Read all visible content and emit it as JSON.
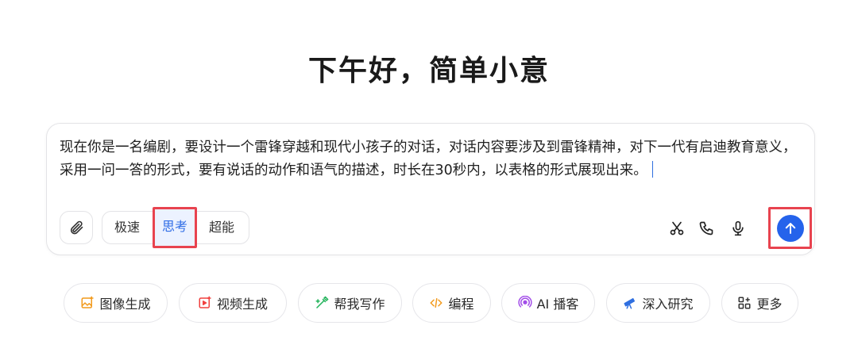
{
  "greeting": "下午好，简单小意",
  "composer": {
    "prompt_text": "现在你是一名编剧，要设计一个雷锋穿越和现代小孩子的对话，对话内容要涉及到雷锋精神，对下一代有启迪教育意义，采用一问一答的形式，要有说话的动作和语气的描述，时长在30秒内，以表格的形式展现出来。",
    "modes": [
      "极速",
      "思考",
      "超能"
    ],
    "active_mode": "思考"
  },
  "icons": {
    "attach": "paperclip-icon",
    "cut": "scissors-icon",
    "phone": "phone-icon",
    "mic": "microphone-icon",
    "send": "arrow-up-icon"
  },
  "chips": [
    {
      "label": "图像生成",
      "icon": "image-generate-icon",
      "color": "#f29a1c"
    },
    {
      "label": "视频生成",
      "icon": "video-generate-icon",
      "color": "#f0413f"
    },
    {
      "label": "帮我写作",
      "icon": "pen-write-icon",
      "color": "#21b35a"
    },
    {
      "label": "编程",
      "icon": "code-icon",
      "color": "#f29a1c"
    },
    {
      "label": "AI 播客",
      "icon": "podcast-icon",
      "color": "#a24de8"
    },
    {
      "label": "深入研究",
      "icon": "telescope-icon",
      "color": "#2f6fe0"
    },
    {
      "label": "更多",
      "icon": "grid-more-icon",
      "color": "#333333"
    }
  ],
  "colors": {
    "accent": "#2563eb",
    "highlight_border": "#e8434f",
    "active_mode_bg": "#ecf2ff"
  }
}
